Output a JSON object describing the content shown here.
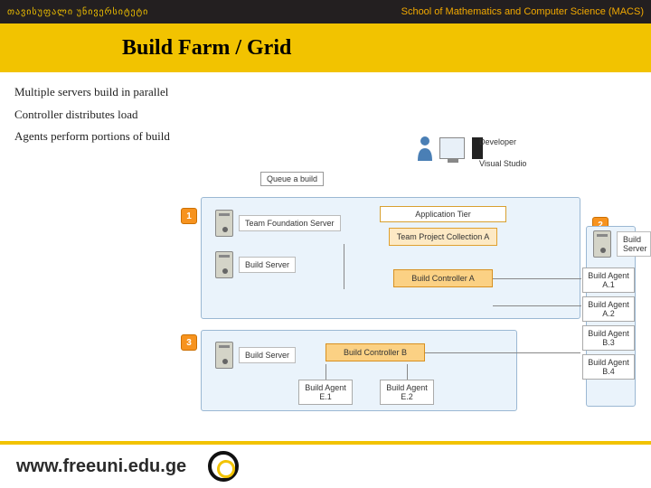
{
  "header": {
    "left": "თავისუფალი უნივერსიტეტი",
    "right": "School of Mathematics and Computer Science (MACS)"
  },
  "title": "Build Farm / Grid",
  "bullets": [
    "Multiple servers build in parallel",
    "Controller distributes load",
    "Agents perform portions of build"
  ],
  "diagram": {
    "developer": "Developer",
    "visual_studio": "Visual Studio",
    "queue": "Queue a build",
    "badges": {
      "n1": "1",
      "n2": "2",
      "n3": "3"
    },
    "tfs": "Team Foundation Server",
    "build_server": "Build Server",
    "app_tier": "Application Tier",
    "proj_coll": "Team Project Collection A",
    "controller_a": "Build Controller A",
    "controller_b": "Build Controller B",
    "agent_a1": "Build Agent A.1",
    "agent_a2": "Build Agent A.2",
    "agent_b3": "Build Agent B.3",
    "agent_b4": "Build Agent B.4",
    "agent_e1": "Build Agent E.1",
    "agent_e2": "Build Agent E.2"
  },
  "footer": {
    "url": "www.freeuni.edu.ge"
  }
}
